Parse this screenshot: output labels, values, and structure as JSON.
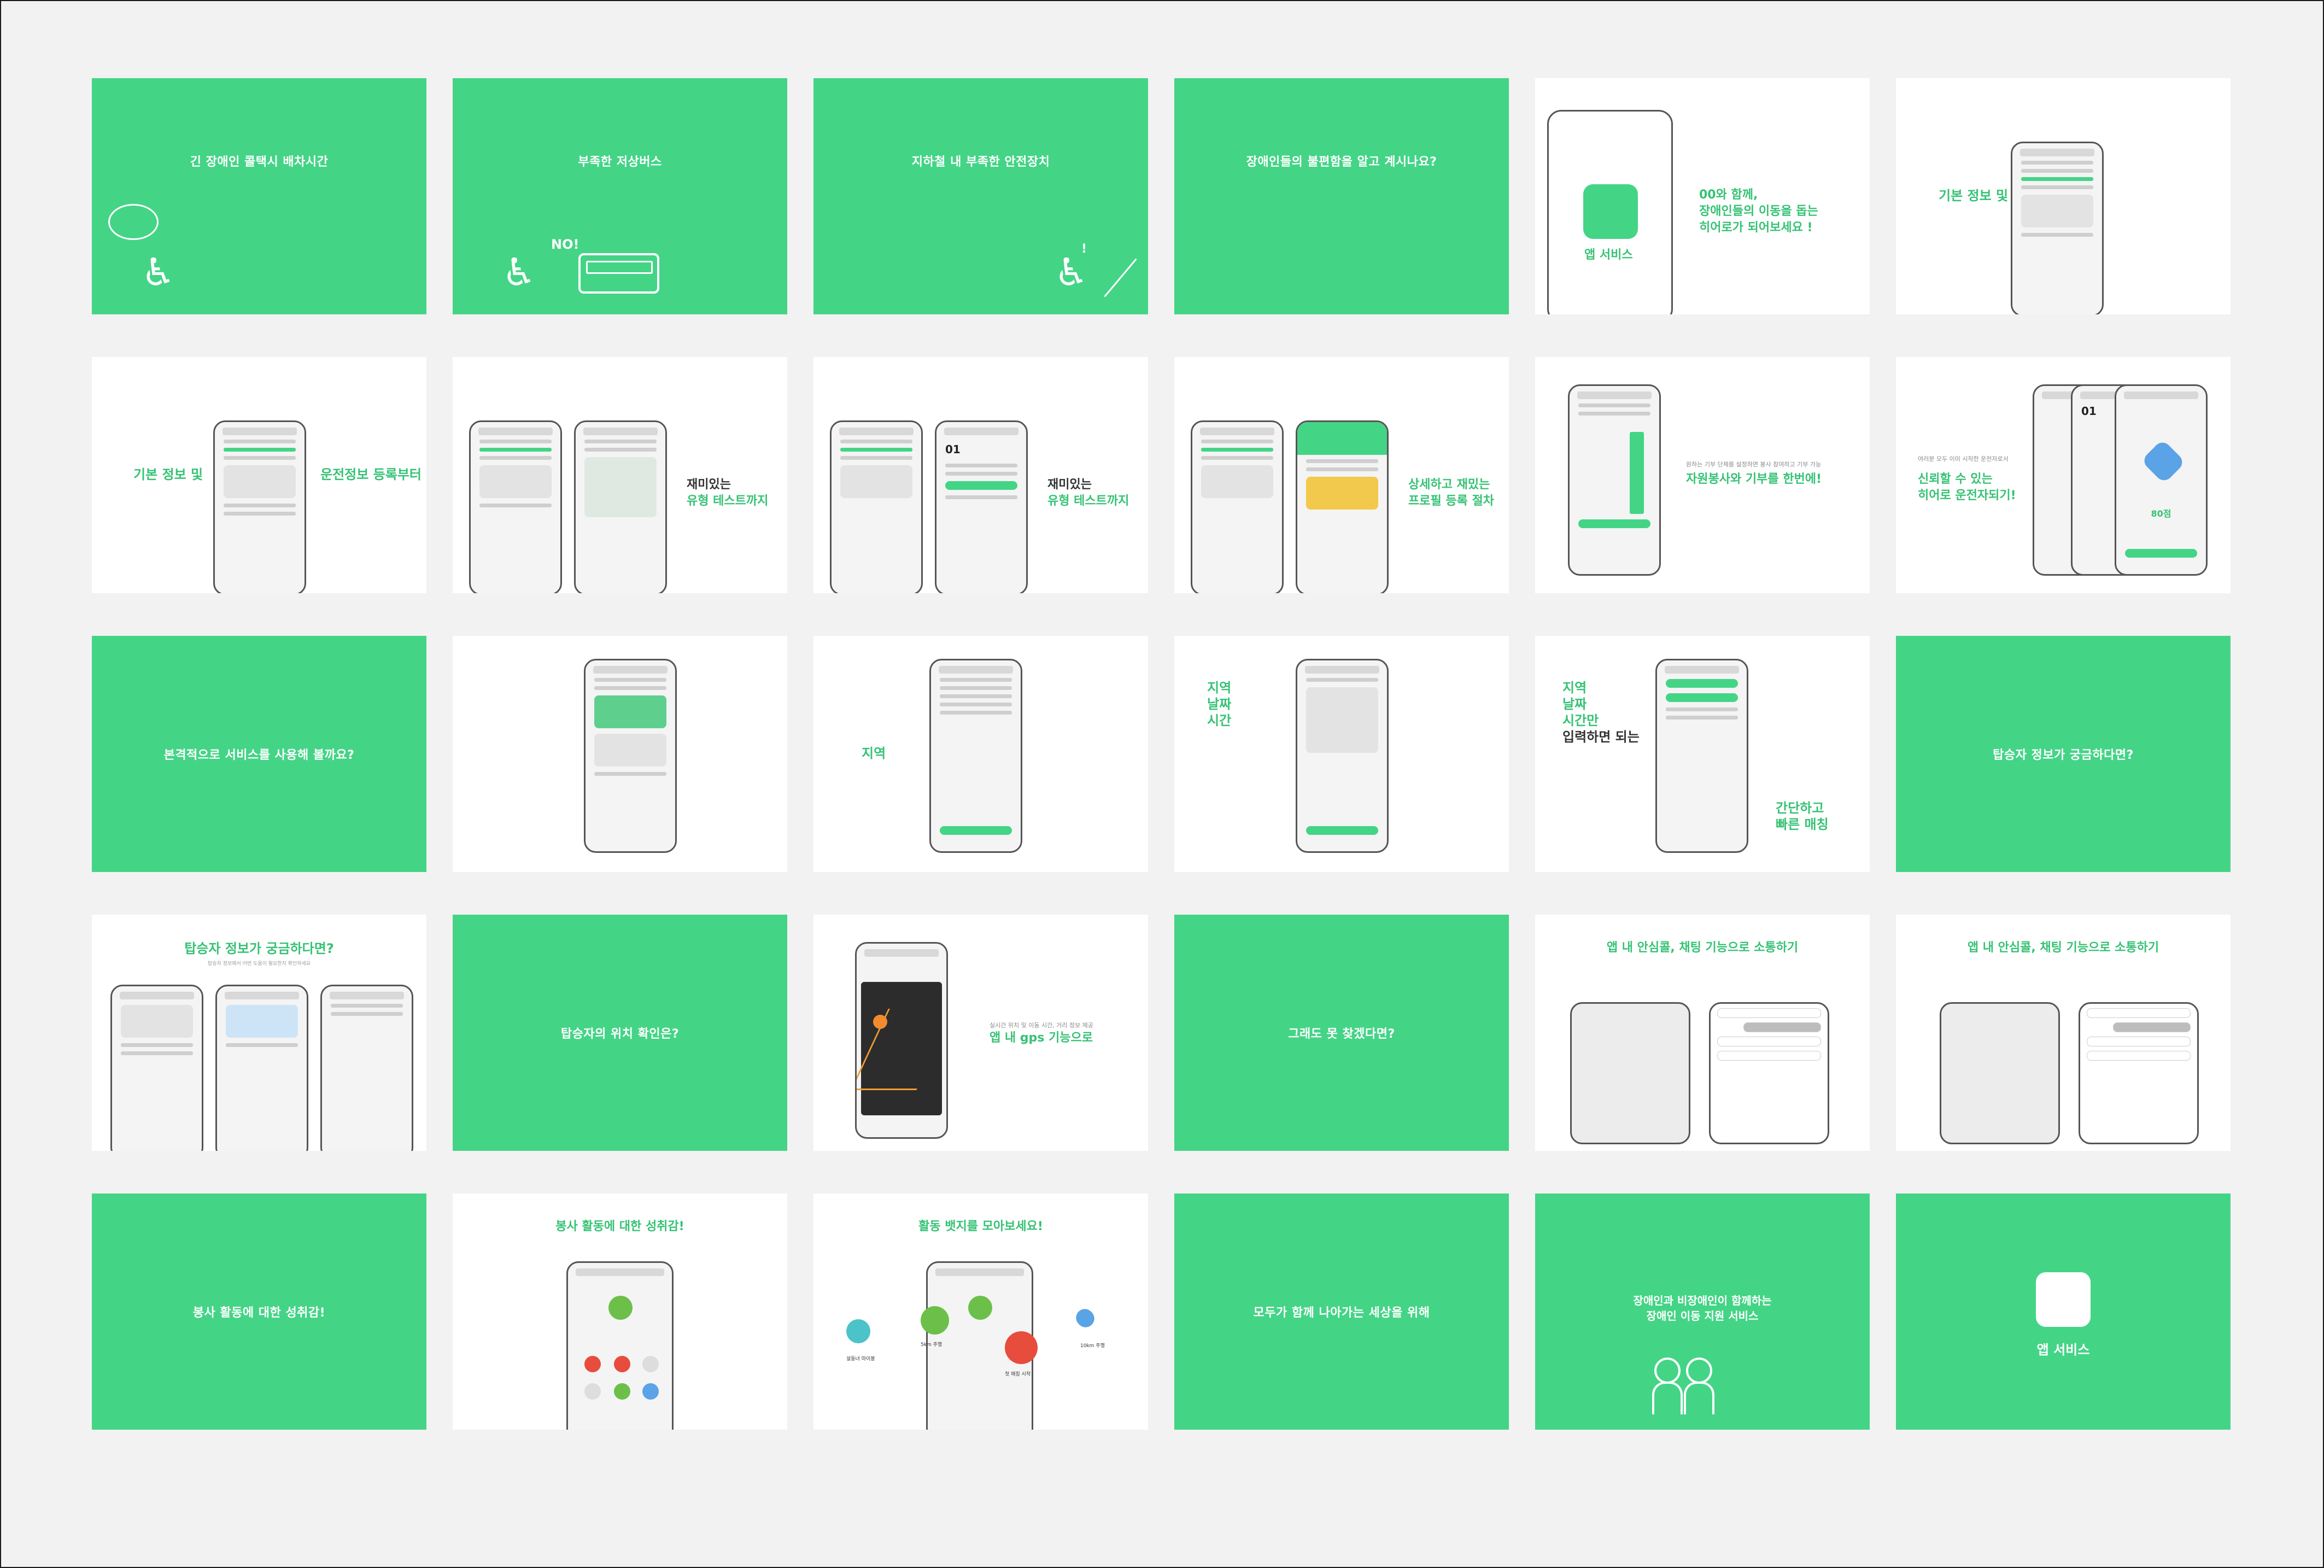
{
  "colors": {
    "accent": "#44d486",
    "accent_text": "#35c274",
    "background": "#f2f2f2"
  },
  "cards": {
    "c1": {
      "title": "긴 장애인 콜택시 배차시간"
    },
    "c2": {
      "title": "부족한 저상버스",
      "no": "NO!"
    },
    "c3": {
      "title": "지하철 내 부족한 안전장치",
      "excl": "!"
    },
    "c4": {
      "title": "장애인들의 불편함을 알고 계시나요?"
    },
    "c5": {
      "app": "앱 서비스",
      "headline1": "00와 함께,",
      "headline2": "장애인들의 이동을 돕는",
      "headline3": "히어로가 되어보세요 !"
    },
    "c6": {
      "label": "기본 정보 및"
    },
    "c7": {
      "left": "기본 정보 및",
      "right": "운전정보 등록부터"
    },
    "c8": {
      "l1": "재미있는",
      "l2": "유형 테스트까지"
    },
    "c9": {
      "l1": "재미있는",
      "l2": "유형 테스트까지",
      "step": "01"
    },
    "c10": {
      "l1": "상세하고 재밌는",
      "l2": "프로필 등록 절차"
    },
    "c11": {
      "small": "원하는 기부 단체를 설정하면 봉사 참여하고 기부 가능",
      "label": "자원봉사와 기부를 한번에!"
    },
    "c12": {
      "small": "여러분 모두 이미 시작한 운전자로서",
      "l1": "신뢰할 수 있는",
      "l2": "히어로 운전자되기!",
      "step": "01",
      "points": "80점"
    },
    "c13": {
      "title": "본격적으로 서비스를 사용해 볼까요?"
    },
    "c15": {
      "label": "지역"
    },
    "c16": {
      "l1": "지역",
      "l2": "날짜",
      "l3": "시간"
    },
    "c17": {
      "l1": "지역",
      "l2": "날짜",
      "l3": "시간만",
      "l4": "입력하면 되는",
      "r1": "간단하고",
      "r2": "빠른 매칭"
    },
    "c18": {
      "title": "탑승자 정보가 궁금하다면?"
    },
    "c19": {
      "title": "탑승자 정보가 궁금하다면?",
      "sub": "탑승자 정보에서 어떤 도움이 필요한지 확인하세요"
    },
    "c20": {
      "title": "탑승자의 위치 확인은?"
    },
    "c21": {
      "small": "실시간 위치 및 이동 시간, 거리 정보 제공",
      "label": "앱 내 gps 기능으로"
    },
    "c22": {
      "title": "그래도 못 찾겠다면?"
    },
    "c23": {
      "title": "앱 내 안심콜, 채팅 기능으로 소통하기"
    },
    "c24": {
      "title": "앱 내 안심콜, 채팅 기능으로 소통하기"
    },
    "c25": {
      "title": "봉사 활동에 대한 성취감!"
    },
    "c26": {
      "title": "봉사 활동에 대한 성취감!"
    },
    "c27": {
      "title": "활동 뱃지를 모아보세요!",
      "b1": "설동녀 마이봉",
      "b2": "5km 주행",
      "b3": "첫 매칭 시작",
      "b4": "10km 주행"
    },
    "c28": {
      "title": "모두가 함께 나아가는 세상을 위해"
    },
    "c29": {
      "l1": "장애인과 비장애인이 함께하는",
      "l2": "장애인 이동 지원 서비스"
    },
    "c30": {
      "app": "앱 서비스"
    }
  }
}
